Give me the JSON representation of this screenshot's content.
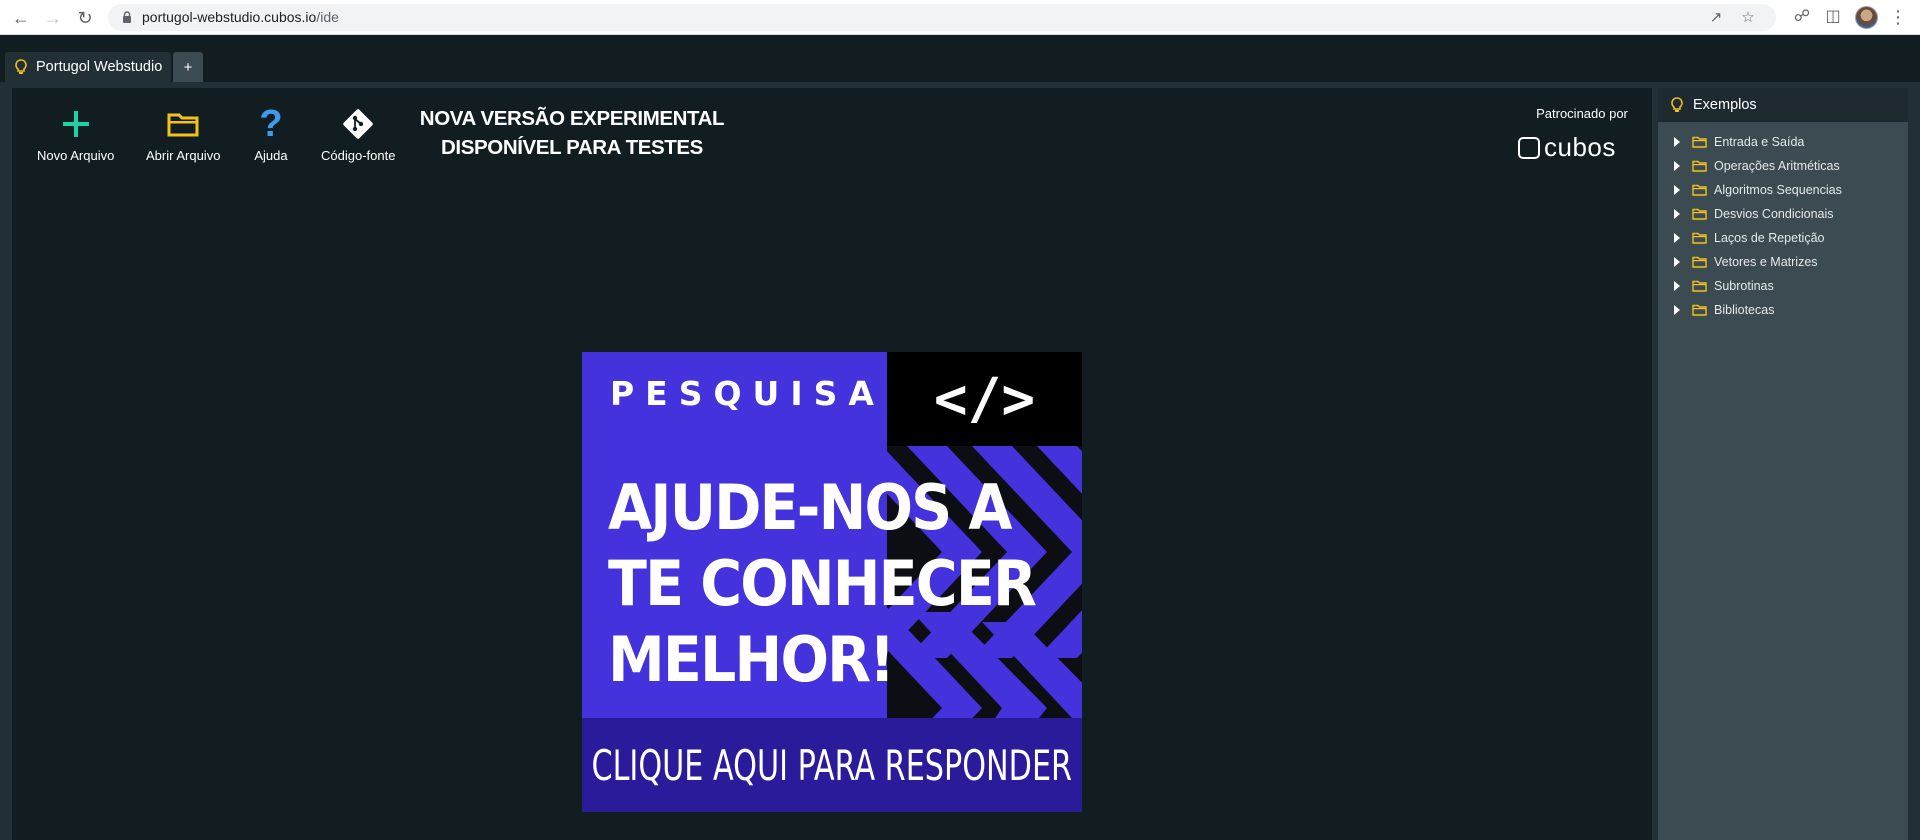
{
  "browser": {
    "url_host": "portugol-webstudio.cubos.io",
    "url_path": "/ide"
  },
  "app_tab": {
    "label": "Portugol Webstudio",
    "add_label": "+"
  },
  "toolbar": {
    "new_file": "Novo Arquivo",
    "open_file": "Abrir Arquivo",
    "help": "Ajuda",
    "source_code": "Código-fonte"
  },
  "headline": {
    "line1": "NOVA VERSÃO EXPERIMENTAL",
    "line2": "DISPONÍVEL PARA TESTES"
  },
  "sponsor": {
    "label": "Patrocinado por",
    "logo_text": "cubos"
  },
  "banner": {
    "kicker": "PESQUISA",
    "code_symbol": "</>",
    "line1": "AJUDE-NOS A",
    "line2": "TE CONHECER",
    "line3": "MELHOR!",
    "cta": "CLIQUE AQUI  PARA RESPONDER"
  },
  "examples": {
    "title": "Exemplos",
    "items": [
      "Entrada e Saída",
      "Operações Aritméticas",
      "Algoritmos Sequencias",
      "Desvios Condicionais",
      "Laços de Repetição",
      "Vetores e Matrizes",
      "Subrotinas",
      "Bibliotecas"
    ]
  },
  "colors": {
    "bg": "#121d22",
    "panel": "#3c4a51",
    "accent_green": "#19d3a2",
    "accent_yellow": "#f2c21b",
    "accent_blue": "#3d9be9",
    "banner_purple": "#4432dc",
    "banner_cta": "#2a1b9a"
  },
  "icons": {
    "back": "arrow-left-icon",
    "forward": "arrow-right-icon",
    "reload": "reload-icon",
    "lock": "lock-icon",
    "share": "share-icon",
    "star": "star-icon",
    "extensions": "puzzle-icon",
    "sidepanel": "side-panel-icon",
    "menu": "kebab-menu-icon"
  }
}
